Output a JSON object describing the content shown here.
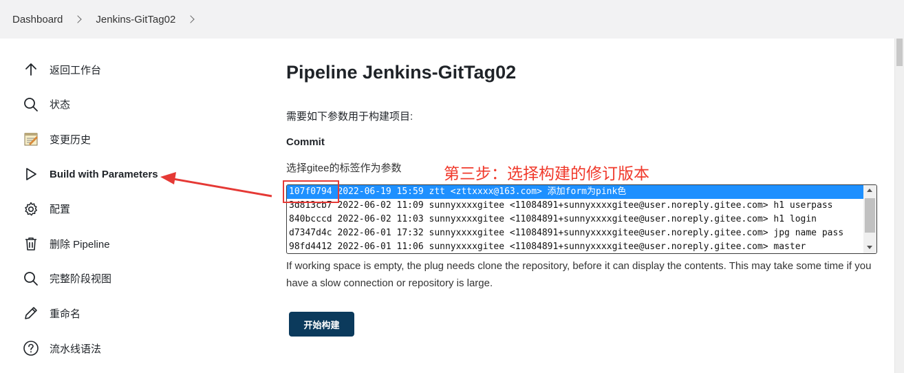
{
  "breadcrumb": {
    "items": [
      "Dashboard",
      "Jenkins-GitTag02"
    ]
  },
  "sidebar": {
    "items": [
      {
        "label": "返回工作台",
        "icon": "arrow-up-icon"
      },
      {
        "label": "状态",
        "icon": "search-icon"
      },
      {
        "label": "变更历史",
        "icon": "notepad-icon"
      },
      {
        "label": "Build with Parameters",
        "icon": "play-icon"
      },
      {
        "label": "配置",
        "icon": "gear-icon"
      },
      {
        "label": "删除 Pipeline",
        "icon": "trash-icon"
      },
      {
        "label": "完整阶段视图",
        "icon": "search-icon"
      },
      {
        "label": "重命名",
        "icon": "pencil-icon"
      },
      {
        "label": "流水线语法",
        "icon": "help-icon"
      }
    ]
  },
  "main": {
    "title": "Pipeline Jenkins-GitTag02",
    "description": "需要如下参数用于构建项目:",
    "parameter": {
      "name": "Commit",
      "description": "选择gitee的标签作为参数",
      "options": [
        "107f0794 2022-06-19 15:59 ztt <zttxxxx@163.com> 添加form为pink色",
        "3d813cb7 2022-06-02 11:09 sunnyxxxxgitee <11084891+sunnyxxxxgitee@user.noreply.gitee.com> h1 userpass",
        "840bcccd 2022-06-02 11:03 sunnyxxxxgitee <11084891+sunnyxxxxgitee@user.noreply.gitee.com> h1 login",
        "d7347d4c 2022-06-01 17:32 sunnyxxxxgitee <11084891+sunnyxxxxgitee@user.noreply.gitee.com> jpg name pass",
        "98fd4412 2022-06-01 11:06 sunnyxxxxgitee <11084891+sunnyxxxxgitee@user.noreply.gitee.com> master"
      ],
      "selected_index": 0
    },
    "help_text": "If working space is empty, the plug needs clone the repository, before it can display the contents. This may take some time if you have a slow connection or repository is large.",
    "build_button": "开始构建"
  },
  "annotation": {
    "text": "第三步：选择构建的修订版本",
    "color": "#f0392b"
  },
  "colors": {
    "accent": "#0b3a5c",
    "selection": "#1e90ff",
    "annotation": "#e53935"
  }
}
